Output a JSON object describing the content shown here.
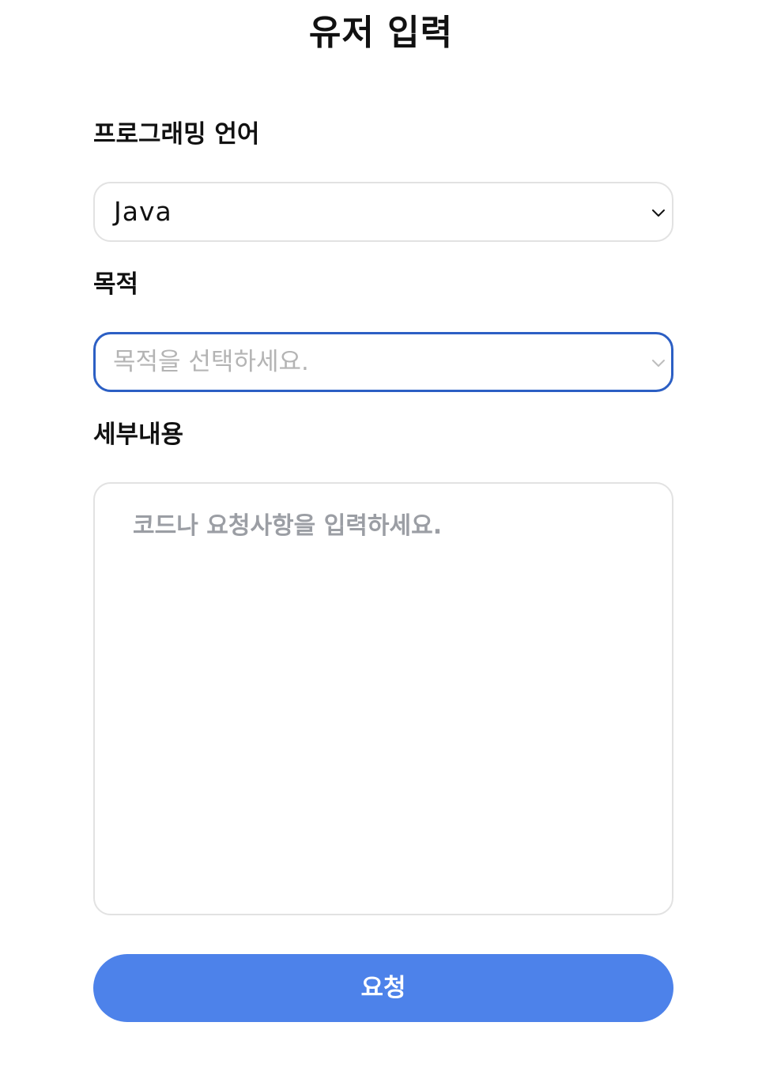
{
  "page": {
    "title": "유저 입력"
  },
  "form": {
    "language": {
      "label": "프로그래밍 언어",
      "selected": "Java"
    },
    "purpose": {
      "label": "목적",
      "placeholder": "목적을 선택하세요.",
      "selected": ""
    },
    "details": {
      "label": "세부내용",
      "placeholder": "코드나 요청사항을 입력하세요.",
      "value": ""
    },
    "submit_label": "요청"
  },
  "colors": {
    "accent": "#4d82ea",
    "focus_border": "#2c5fc4",
    "input_border": "#e2e2e2",
    "placeholder": "#b4b4b4"
  },
  "icons": {
    "dropdown": "chevron-down-icon"
  }
}
